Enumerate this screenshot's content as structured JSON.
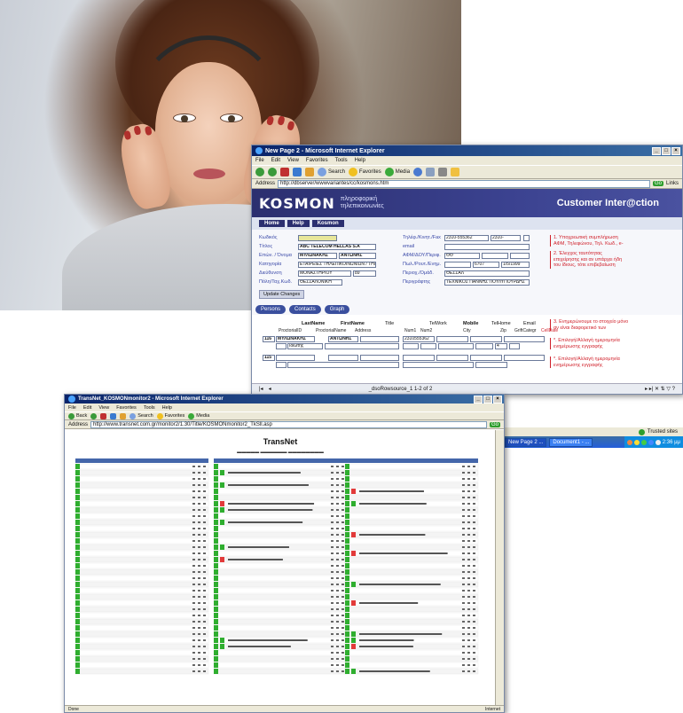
{
  "kosmon_window": {
    "title": "New Page 2 - Microsoft Internet Explorer",
    "menu": [
      "File",
      "Edit",
      "View",
      "Favorites",
      "Tools",
      "Help"
    ],
    "toolbar": {
      "search": "Search",
      "favorites": "Favorites",
      "media": "Media"
    },
    "address_label": "Address",
    "address_url": "http://dbserver/wwwvariantes/cc/kosmons.htm",
    "go": "Go",
    "links": "Links",
    "logo": "KOSMON",
    "tagline_1": "πληροφορική",
    "tagline_2": "τηλεπικοινωνίες",
    "app_title": "Customer Inter@ction",
    "nav": [
      "Home",
      "Help",
      "Kosmon"
    ],
    "labels_left": [
      "Κωδικός",
      "Τίτλος",
      "Επών. / Όνομα",
      "Κατηγορία",
      "Διεύθυνση",
      "Πόλη/Ταχ.Κωδ."
    ],
    "labels_right": [
      "Τηλέφ./Κινητ./Fax",
      "email",
      "ΑΦΜ/ΔΟΥ/Περιφ.",
      "Πωλ./Ρουτ./Ενημ.",
      "Περιοχ./Ομάδ.",
      "Περιγράφτης"
    ],
    "values": {
      "title": "ABC TELECOM HELLAS S.A",
      "surname": "ΜΥΛΩΝΑΚΗΣ",
      "name": "ΑΝΤΩΝΗΣ",
      "category": "ΕΤΑΙΡΕΙΕΣ ΤΗΛΕΠΙΚΟΙΝΩΝΙΩΝ / ΤΗΛΕΦΩΝΙΑ",
      "address": "ΜΟΝΑΣΤΗΡΙΟΥ",
      "address_no": "89",
      "city": "ΘΕΣΣΑΛΟΝΙΚΗ",
      "phone": "2310-555362",
      "phone2": "2310-",
      "afm": "ΘΘ",
      "route": "6707",
      "date": "1/5/1999",
      "region": "ΘΕΣΣΑΛ",
      "sales_rep": "ΤΕΧΝΙΚΟΣ ΠΑΝΝΗΣ ΠΟΥΛΥΠΟΥΡΔΗΣ"
    },
    "notes": {
      "n1": "1. Υποχρεωτική συμπλήρωση ΑΦΜ, Τηλεφώνου, Τηλ. Κωδ., e-",
      "n2": "2. Έλεγχος ταυτότητας επιχείρησης και αν υπάρχει ήδη του ίδιους, τότε επιβεβαίωση",
      "n3": "3. Ενημερώνουμε το στοιχείο μόνο αν είναι διαφορετικό των",
      "n4": "*. Επιλογή/Αλλαγή ημερομηνία ενημέρωσης εγγραφής",
      "n5": "*. Επιλογή/Αλλαγή ημερομηνία ενημέρωσης εγγραφής"
    },
    "update_button": "Update Changes",
    "tabs": [
      "Persons",
      "Contacts",
      "Graph"
    ],
    "grid_headers": [
      "LastName",
      "FirstName",
      "Title",
      "TelWork",
      "Mobile",
      "TelHome",
      "Email"
    ],
    "grid_subheaders": [
      "ProctorialID",
      "ProctorialName",
      "Address",
      "Num1",
      "Num2",
      "City",
      "Zip",
      "GriftCategr",
      "CellDate"
    ],
    "grid_row1": {
      "id": "116",
      "last": "ΜΥΛΩΝΑΚΗΣ",
      "first": "ΑΝΤΩΝΗΣ",
      "tel": "2310555362",
      "sub": "Ιδιώτης",
      "code": "4"
    },
    "grid_row2": {
      "id": "115"
    },
    "status_text": "_dsoRowsource_1 1-2 of 2"
  },
  "transnet_window": {
    "title": "TransNet_KOSMONmonitor2 - Microsoft Internet Explorer",
    "menu": [
      "File",
      "Edit",
      "View",
      "Favorites",
      "Tools",
      "Help"
    ],
    "toolbar": {
      "back": "Back",
      "search": "Search",
      "favorites": "Favorites",
      "media": "Media"
    },
    "address_label": "Address",
    "address_url": "http://www.transnet.com.gr/monitor2/1.30/Title/KOSMONmonitor2_TkSll.asp",
    "go": "Go",
    "page_title": "TransNet",
    "status_left": "Done",
    "status_right": "Internet"
  },
  "taskbar": {
    "trusted_sites": "Trusted sites",
    "items": [
      "New Page 2 ...",
      "Document1 - ..."
    ],
    "clock": "2:36 μμ"
  },
  "chart_data": {
    "type": "table",
    "colors": {
      "on": "#2fae2f",
      "alert": "#e23a3a",
      "neutral": "#bfbfbf",
      "header": "#4466aa"
    }
  }
}
